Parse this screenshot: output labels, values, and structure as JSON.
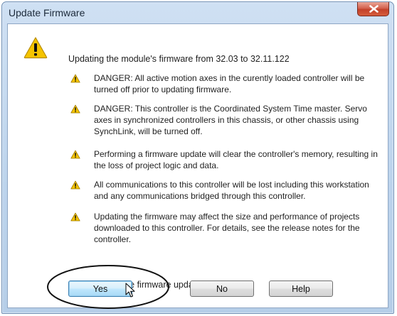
{
  "window": {
    "title": "Update Firmware"
  },
  "message": {
    "intro": "Updating the module's firmware from 32.03 to 32.11.122",
    "items": [
      {
        "text": "DANGER: All active motion axes in the curently loaded controller will be turned off prior to updating firmware."
      },
      {
        "text": "DANGER: This controller is the Coordinated System Time master. Servo axes in synchronized controllers in this chassis, or other chassis using SynchLink, will be turned off."
      },
      {
        "text": "Performing a firmware update will clear the controller's memory, resulting in the loss of project logic and data."
      },
      {
        "text": "All communications to this controller will be lost including this workstation and any communications bridged through this controller."
      },
      {
        "text": "Updating the firmware may affect the size and performance of projects downloaded to this controller.  For details, see the release notes for the controller."
      }
    ],
    "question": "Proceed with the firmware update?"
  },
  "buttons": {
    "yes": "Yes",
    "no": "No",
    "help": "Help"
  },
  "colors": {
    "warning": "#f5c400",
    "annotation_ring": "#111111"
  }
}
